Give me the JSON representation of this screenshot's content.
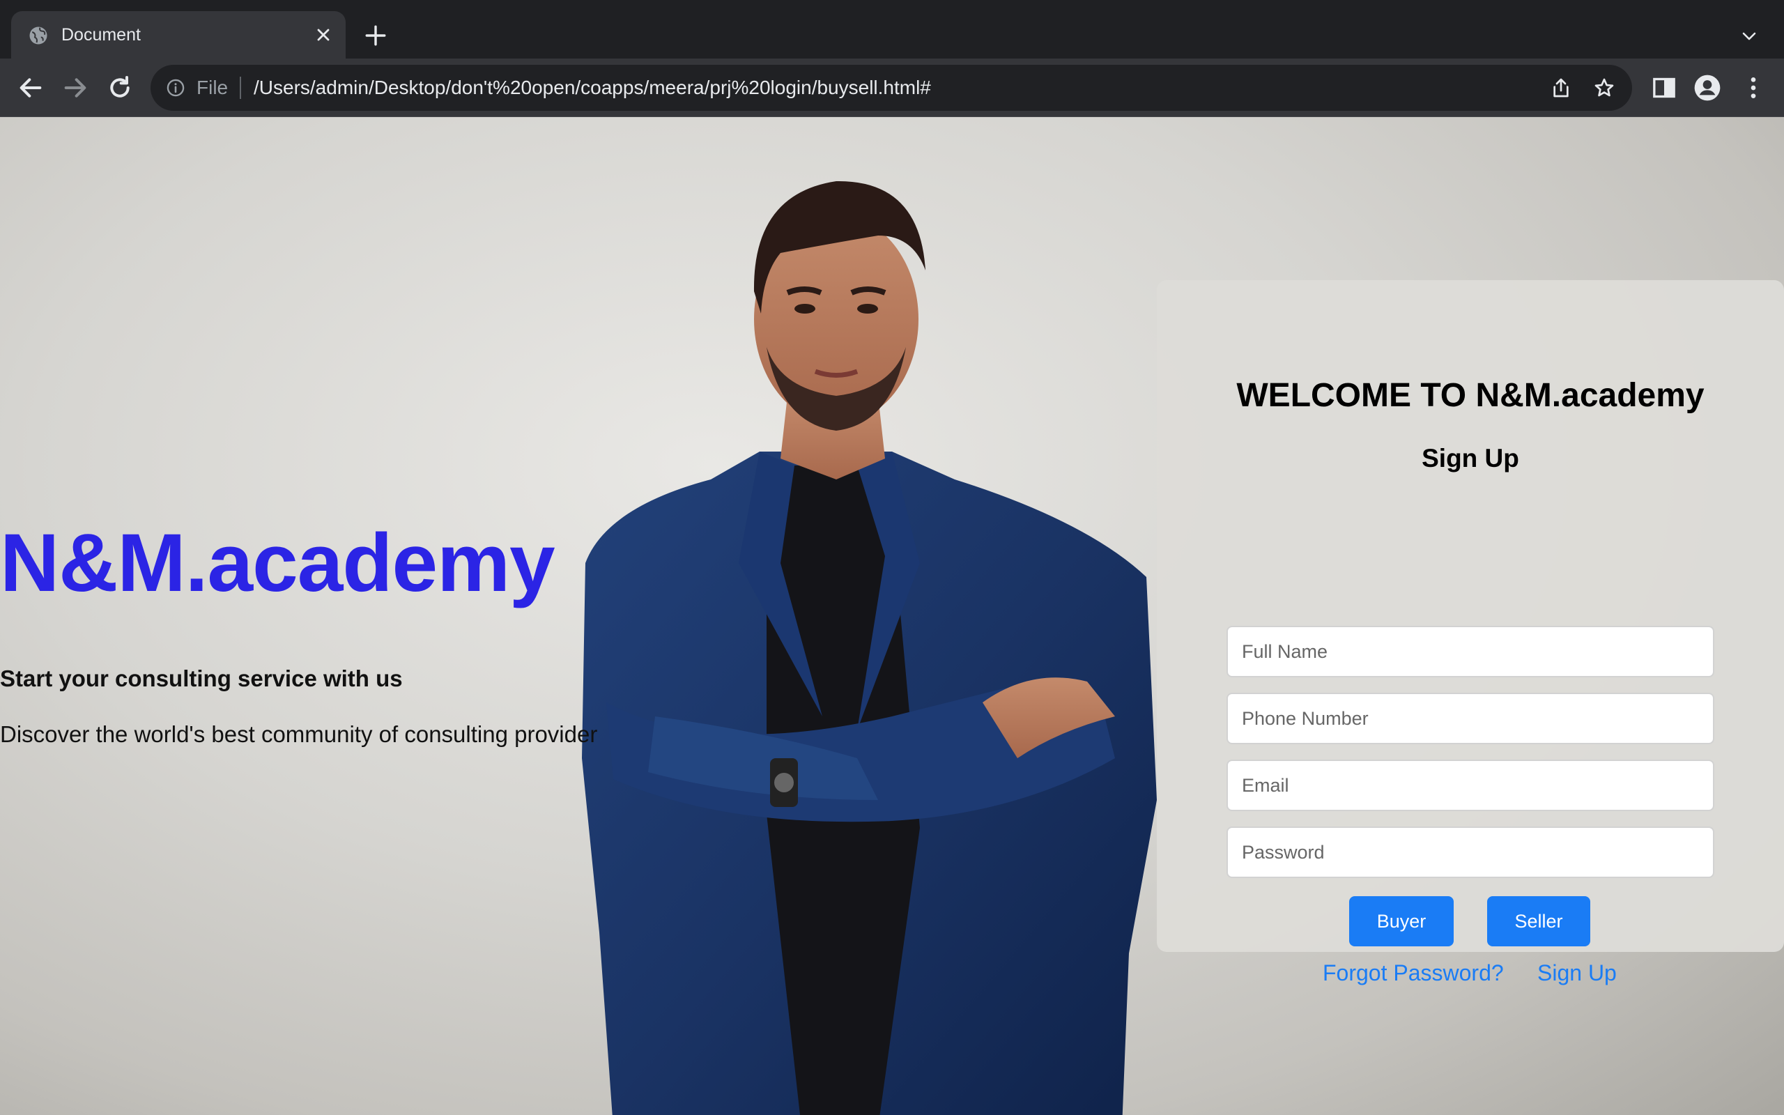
{
  "browser": {
    "tab_title": "Document",
    "url_scheme_label": "File",
    "url": "/Users/admin/Desktop/don't%20open/coapps/meera/prj%20login/buysell.html#"
  },
  "hero": {
    "brand": "N&M.academy",
    "tagline": "Start your consulting service with us",
    "subline": "Discover the world's best community of consulting provider"
  },
  "signup_card": {
    "welcome": "WELCOME TO N&M.academy",
    "title": "Sign Up",
    "fields": {
      "full_name_placeholder": "Full Name",
      "phone_placeholder": "Phone Number",
      "email_placeholder": "Email",
      "password_placeholder": "Password"
    },
    "buyer_label": "Buyer",
    "seller_label": "Seller",
    "forgot_password_label": "Forgot Password?",
    "signup_link_label": "Sign Up"
  },
  "colors": {
    "brand": "#2b24e5",
    "primary_button": "#1a7cf5",
    "chrome_bg": "#35363a",
    "chrome_tabstrip": "#1f2023"
  },
  "icons": [
    "globe-icon",
    "close-icon",
    "plus-icon",
    "chevron-down-icon",
    "back-arrow-icon",
    "forward-arrow-icon",
    "reload-icon",
    "info-icon",
    "share-icon",
    "star-icon",
    "side-panel-icon",
    "profile-icon",
    "kebab-menu-icon"
  ]
}
